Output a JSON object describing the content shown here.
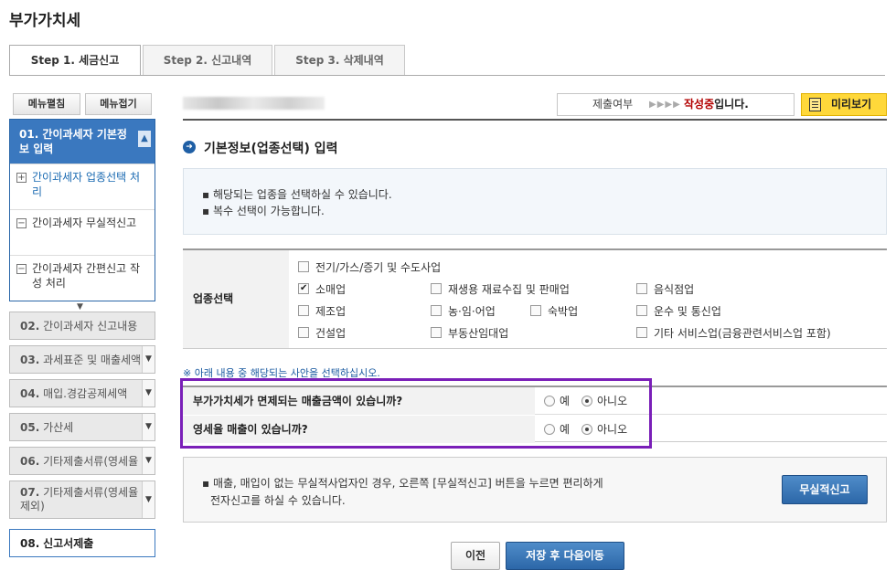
{
  "page": {
    "title": "부가가치세"
  },
  "tabs": [
    {
      "label": "Step 1. 세금신고",
      "active": true
    },
    {
      "label": "Step 2. 신고내역",
      "active": false
    },
    {
      "label": "Step 3. 삭제내역",
      "active": false
    }
  ],
  "sidebar": {
    "expand_label": "메뉴펼침",
    "collapse_label": "메뉴접기",
    "active_section": {
      "label": "01. 간이과세자 기본정보 입력",
      "items": [
        {
          "label": "간이과세자 업종선택 처리",
          "icon": "plus-box-icon",
          "selected": true
        },
        {
          "label": "간이과세자 무실적신고",
          "icon": "minus-box-icon",
          "selected": false
        },
        {
          "label": "간이과세자 간편신고 작성 처리",
          "icon": "minus-box-icon",
          "selected": false
        }
      ]
    },
    "menu": [
      {
        "num": "02.",
        "label": "간이과세자 신고내용"
      },
      {
        "num": "03.",
        "label": "과세표준 및 매출세액"
      },
      {
        "num": "04.",
        "label": "매입.경감공제세액"
      },
      {
        "num": "05.",
        "label": "가산세"
      },
      {
        "num": "06.",
        "label": "기타제출서류(영세율"
      },
      {
        "num": "07.",
        "label": "기타제출서류(영세율 제외)"
      },
      {
        "num": "08.",
        "label": "신고서제출"
      }
    ]
  },
  "status": {
    "label": "제출여부",
    "arrows": "▶▶▶▶",
    "value_highlight": "작성중",
    "value_rest": "입니다."
  },
  "preview_button": "미리보기",
  "section": {
    "title": "기본정보(업종선택) 입력",
    "info": [
      "해당되는 업종을 선택하실 수 있습니다.",
      "복수 선택이 가능합니다."
    ]
  },
  "industry": {
    "label": "업종선택",
    "options": [
      {
        "label": "전기/가스/증기 및 수도사업",
        "checked": false
      },
      {
        "label": "소매업",
        "checked": true
      },
      {
        "label": "재생용 재료수집 및 판매업",
        "checked": false
      },
      {
        "label": "음식점업",
        "checked": false
      },
      {
        "label": "제조업",
        "checked": false
      },
      {
        "label": "농·임·어업",
        "checked": false
      },
      {
        "label": "숙박업",
        "checked": false
      },
      {
        "label": "운수 및 통신업",
        "checked": false
      },
      {
        "label": "건설업",
        "checked": false
      },
      {
        "label": "부동산임대업",
        "checked": false
      },
      {
        "label": "기타 서비스업(금융관련서비스업 포함)",
        "checked": false
      }
    ]
  },
  "notice": "※ 아래 내용 중 해당되는 사안을 선택하십시오.",
  "questions": [
    {
      "label": "부가가치세가 면제되는 매출금액이 있습니까?",
      "yes": "예",
      "no": "아니오",
      "selected": "no"
    },
    {
      "label": "영세율 매출이 있습니까?",
      "yes": "예",
      "no": "아니오",
      "selected": "no"
    }
  ],
  "no_performance": {
    "text_line1": "매출, 매입이 없는 무실적사업자인 경우, 오른쪽 [무실적신고] 버튼을 누르면 편리하게",
    "text_line2": "전자신고를 하실 수 있습니다.",
    "button": "무실적신고"
  },
  "footer": {
    "prev_label": "이전",
    "next_label": "저장 후 다음이동"
  },
  "colors": {
    "accent": "#3a78bf",
    "highlight": "#7a1fb8",
    "status_red": "#b20000",
    "preview_yellow": "#ffd83a"
  }
}
